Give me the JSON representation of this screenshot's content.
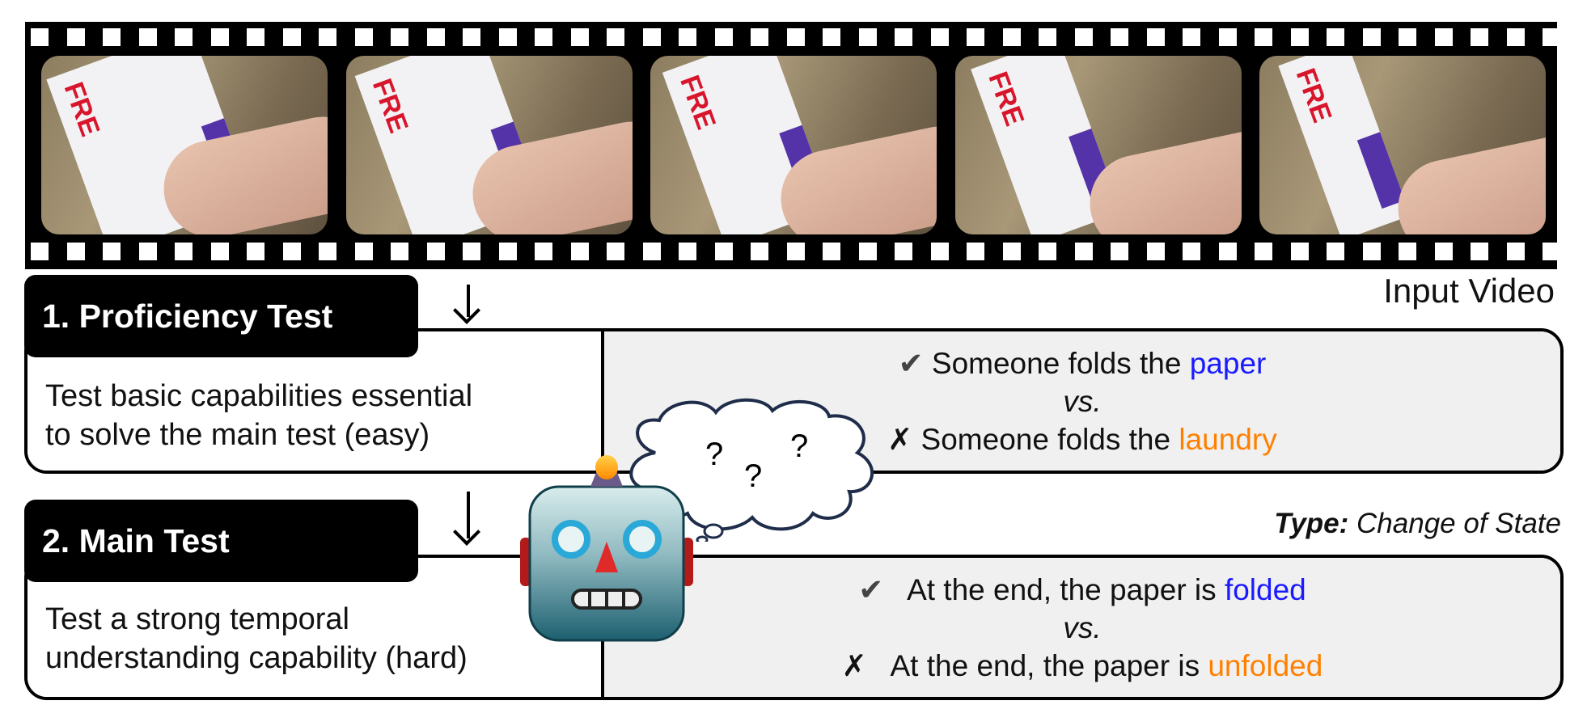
{
  "video": {
    "caption": "Input Video",
    "frame_count": 5
  },
  "proficiency": {
    "title": "1. Proficiency Test",
    "description_lines": [
      "Test basic capabilities essential",
      "to solve the main test (easy)"
    ],
    "correct": {
      "mark": "✔",
      "prefix": "Someone folds the ",
      "keyword": "paper"
    },
    "vs": "vs.",
    "wrong": {
      "mark": "✗",
      "prefix": "Someone folds the ",
      "keyword": "laundry"
    }
  },
  "main": {
    "title": "2. Main Test",
    "type_label": "Type:",
    "type_value": "Change of State",
    "description_lines": [
      "Test a strong temporal",
      "understanding capability (hard)"
    ],
    "correct": {
      "mark": "✔",
      "prefix": "At the end, the paper is ",
      "keyword": "folded"
    },
    "vs": "vs.",
    "wrong": {
      "mark": "✗",
      "prefix": "At the end, the paper is ",
      "keyword": "unfolded"
    }
  },
  "thought": {
    "marks": [
      "?",
      "?",
      "?"
    ]
  },
  "colors": {
    "correct_keyword": "#1a1aff",
    "wrong_keyword": "#ff8000",
    "panel_bg": "#f0f0f0"
  },
  "icons": {
    "robot": "robot-icon",
    "thought": "thought-bubble-icon"
  }
}
